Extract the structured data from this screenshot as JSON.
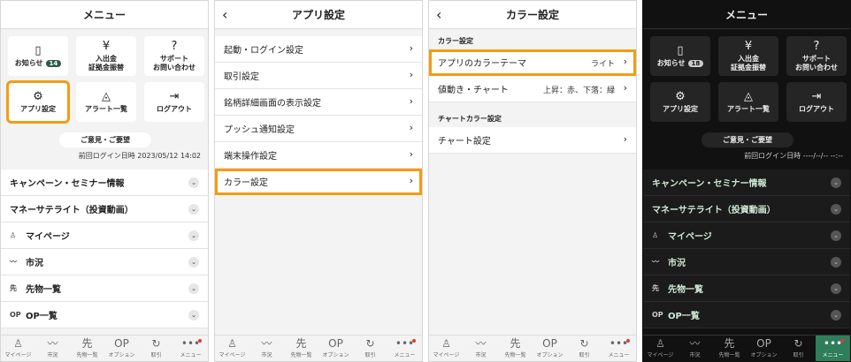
{
  "panel1": {
    "title": "メニュー",
    "tiles": [
      {
        "label": "お知らせ",
        "badge": "14",
        "icon": "📄"
      },
      {
        "label": "入出金\n証拠金振替",
        "icon": "¥"
      },
      {
        "label": "サポート\nお問い合わせ",
        "icon": "?"
      },
      {
        "label": "アプリ設定",
        "icon": "⚙"
      },
      {
        "label": "アラート一覧",
        "icon": "🔔"
      },
      {
        "label": "ログアウト",
        "icon": "⇥"
      }
    ],
    "opinion_label": "ご意見・ご要望",
    "last_login": "前回ログイン日時 2023/05/12 14:02",
    "items": [
      {
        "label": "キャンペーン・セミナー情報",
        "icon": ""
      },
      {
        "label": "マネーサテライト（投資動画）",
        "icon": ""
      },
      {
        "label": "マイページ",
        "icon": "👤"
      },
      {
        "label": "市況",
        "icon": "〰"
      },
      {
        "label": "先物一覧",
        "icon": "先"
      },
      {
        "label": "OP一覧",
        "icon": "OP"
      }
    ]
  },
  "panel2": {
    "title": "アプリ設定",
    "items": [
      "起動・ログイン設定",
      "取引設定",
      "銘柄詳細画面の表示設定",
      "プッシュ通知設定",
      "端末操作設定",
      "カラー設定"
    ]
  },
  "panel3": {
    "title": "カラー設定",
    "section1": "カラー設定",
    "theme_label": "アプリのカラーテーマ",
    "theme_value": "ライト",
    "price_label": "値動き・チャート",
    "price_value": "上昇：赤、下落：緑",
    "section2": "チャートカラー設定",
    "chart_label": "チャート設定"
  },
  "panel4": {
    "title": "メニュー",
    "tiles": [
      {
        "label": "お知らせ",
        "badge": "18",
        "icon": "📄"
      },
      {
        "label": "入出金\n証拠金振替",
        "icon": "¥"
      },
      {
        "label": "サポート\nお問い合わせ",
        "icon": "?"
      },
      {
        "label": "アプリ設定",
        "icon": "⚙"
      },
      {
        "label": "アラート一覧",
        "icon": "🔔"
      },
      {
        "label": "ログアウト",
        "icon": "⇥"
      }
    ],
    "opinion_label": "ご意見・ご要望",
    "last_login": "前回ログイン日時 ----/--/-- --:--",
    "items": [
      {
        "label": "キャンペーン・セミナー情報",
        "icon": ""
      },
      {
        "label": "マネーサテライト（投資動画）",
        "icon": ""
      },
      {
        "label": "マイページ",
        "icon": "👤"
      },
      {
        "label": "市況",
        "icon": "〰"
      },
      {
        "label": "先物一覧",
        "icon": "先"
      },
      {
        "label": "OP一覧",
        "icon": "OP"
      }
    ]
  },
  "tabbar": {
    "tabs": [
      {
        "label": "マイページ",
        "icon": "👤"
      },
      {
        "label": "市況",
        "icon": "〰"
      },
      {
        "label": "先物一覧",
        "icon": "先"
      },
      {
        "label": "オプション",
        "icon": "OP"
      },
      {
        "label": "取引",
        "icon": "↻"
      },
      {
        "label": "メニュー",
        "icon": "•••"
      }
    ]
  },
  "colors": {
    "highlight": "#f39c12",
    "accent_green": "#2e7d5b",
    "badge_green": "#2e5a4c",
    "dark_bg": "#111111"
  }
}
